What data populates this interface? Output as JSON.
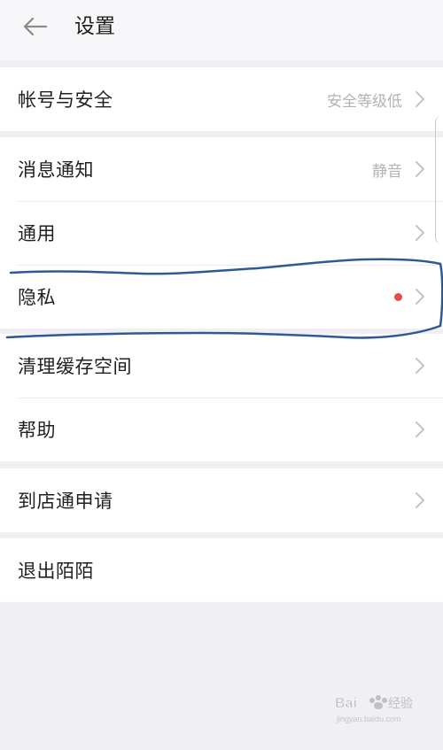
{
  "header": {
    "title": "设置",
    "back_icon": "back-arrow-icon"
  },
  "sections": [
    {
      "items": [
        {
          "label": "帐号与安全",
          "value": "安全等级低",
          "chevron": true
        }
      ]
    },
    {
      "items": [
        {
          "label": "消息通知",
          "value": "静音",
          "chevron": true
        },
        {
          "label": "通用",
          "chevron": true
        },
        {
          "label": "隐私",
          "badge": "red-dot",
          "chevron": true
        }
      ]
    },
    {
      "items": [
        {
          "label": "清理缓存空间",
          "chevron": true
        },
        {
          "label": "帮助",
          "chevron": true
        }
      ]
    },
    {
      "items": [
        {
          "label": "到店通申请",
          "chevron": true
        }
      ]
    },
    {
      "items": [
        {
          "label": "退出陌陌",
          "chevron": false
        }
      ]
    }
  ],
  "colors": {
    "background": "#efeff4",
    "card": "#ffffff",
    "text": "#1f1f1f",
    "secondary_text": "#b3b3b3",
    "badge": "#e64a4a",
    "annotation_ink": "#2d5a96"
  },
  "watermark": {
    "text": "Bai经验",
    "subtext": "jingyan.baidu.com"
  }
}
